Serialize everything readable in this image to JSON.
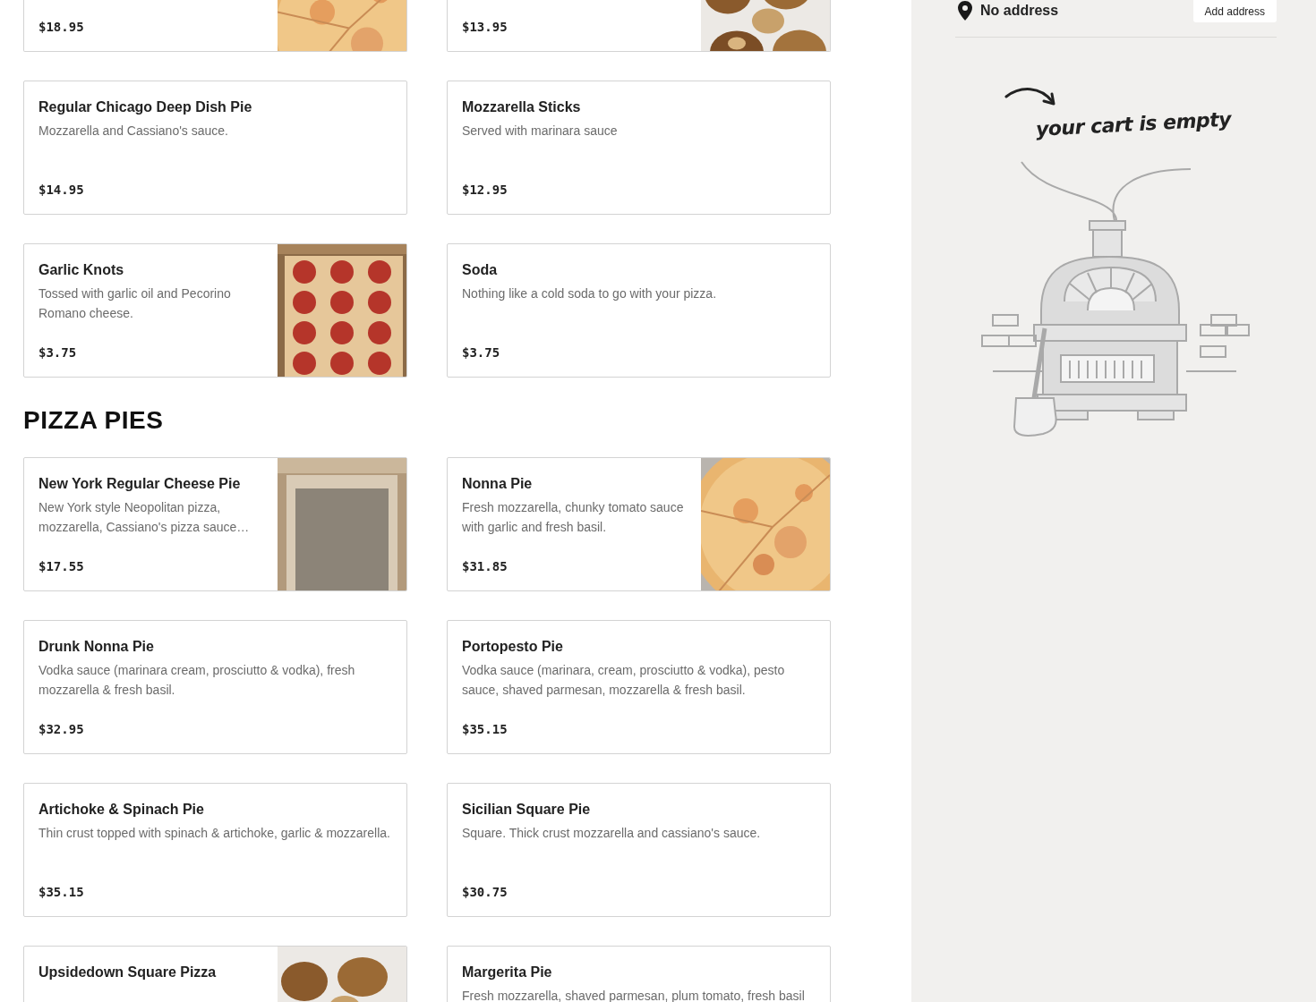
{
  "menu": {
    "sections": [
      {
        "items": [
          {
            "price": "$18.95"
          },
          {
            "price": "$13.95"
          },
          {
            "name": "Regular Chicago Deep Dish Pie",
            "description": "Mozzarella and Cassiano's sauce.",
            "price": "$14.95"
          },
          {
            "name": "Mozzarella Sticks",
            "description": "Served with marinara sauce",
            "price": "$12.95"
          },
          {
            "name": "Garlic Knots",
            "description": "Tossed with garlic oil and Pecorino Romano cheese.",
            "price": "$3.75"
          },
          {
            "name": "Soda",
            "description": "Nothing like a cold soda to go with your pizza.",
            "price": "$3.75"
          }
        ]
      },
      {
        "heading": "PIZZA PIES",
        "items": [
          {
            "name": "New York Regular Cheese Pie",
            "description": "New York style Neopolitan pizza, mozzarella, Cassiano's pizza sauce…",
            "price": "$17.55"
          },
          {
            "name": "Nonna Pie",
            "description": "Fresh mozzarella, chunky tomato sauce with garlic and fresh basil.",
            "price": "$31.85"
          },
          {
            "name": "Drunk Nonna Pie",
            "description": "Vodka sauce (marinara cream, prosciutto & vodka), fresh mozzarella & fresh basil.",
            "price": "$32.95"
          },
          {
            "name": "Portopesto Pie",
            "description": "Vodka sauce (marinara, cream, prosciutto & vodka), pesto sauce, shaved parmesan, mozzarella & fresh basil.",
            "price": "$35.15"
          },
          {
            "name": "Artichoke & Spinach Pie",
            "description": "Thin crust topped with spinach & artichoke, garlic & mozzarella.",
            "price": "$35.15"
          },
          {
            "name": "Sicilian Square Pie",
            "description": "Square. Thick crust mozzarella and cassiano's sauce.",
            "price": "$30.75"
          },
          {
            "name": "Upsidedown Square Pizza"
          },
          {
            "name": "Margerita Pie",
            "description": "Fresh mozzarella, shaved parmesan, plum tomato, fresh basil"
          }
        ]
      }
    ]
  },
  "cart": {
    "address": "No address",
    "add_address_button": "Add address",
    "empty_message": "your cart is empty"
  }
}
